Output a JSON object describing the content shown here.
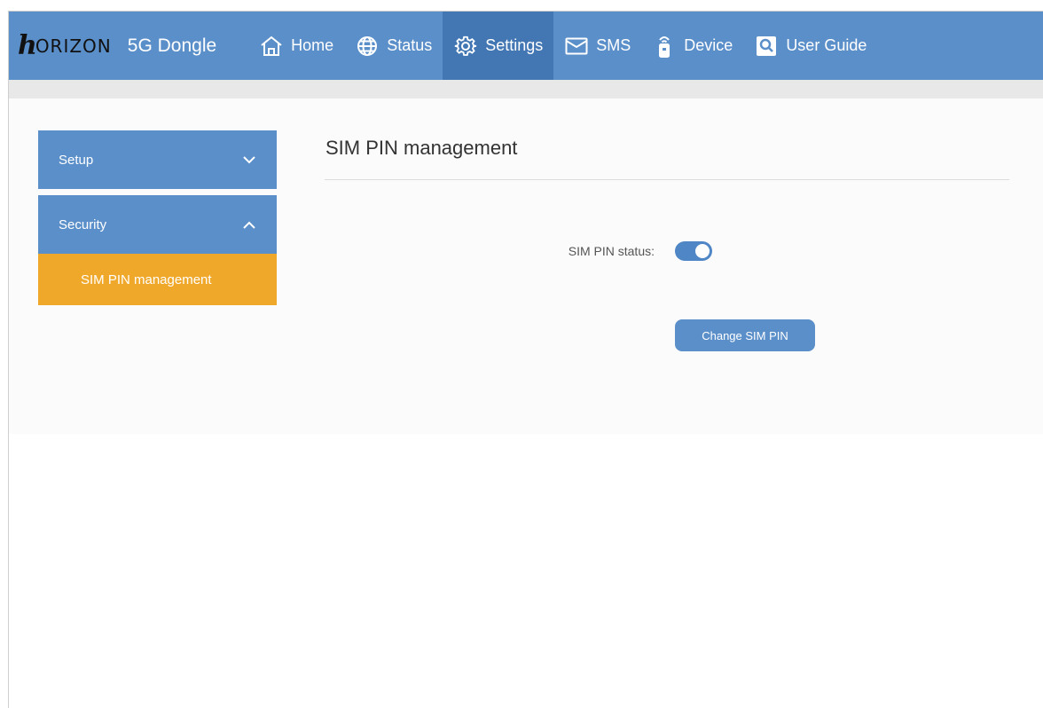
{
  "brand": {
    "logo_mark": "h",
    "logo_text": "ORIZON",
    "product": "5G Dongle"
  },
  "nav": {
    "items": [
      {
        "label": "Home",
        "icon": "home-icon"
      },
      {
        "label": "Status",
        "icon": "globe-icon"
      },
      {
        "label": "Settings",
        "icon": "gear-icon",
        "active": true
      },
      {
        "label": "SMS",
        "icon": "envelope-icon"
      },
      {
        "label": "Device",
        "icon": "device-icon"
      },
      {
        "label": "User Guide",
        "icon": "search-icon"
      }
    ]
  },
  "sidebar": {
    "sections": [
      {
        "label": "Setup",
        "expanded": false
      },
      {
        "label": "Security",
        "expanded": true,
        "items": [
          {
            "label": "SIM PIN management",
            "active": true
          }
        ]
      }
    ]
  },
  "main": {
    "title": "SIM PIN management",
    "sim_pin_status_label": "SIM PIN status:",
    "sim_pin_status_enabled": true,
    "change_button_label": "Change SIM PIN"
  },
  "colors": {
    "header": "#5b8fc9",
    "header_active": "#4377b4",
    "sidebar_active": "#f0a82a",
    "toggle_on": "#4f86c6"
  }
}
